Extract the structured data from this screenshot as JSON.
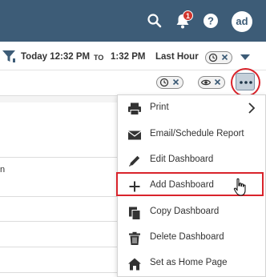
{
  "header": {
    "notification_count": "1",
    "avatar_initials": "ad",
    "bg_color": "#3d5c77"
  },
  "time_filter": {
    "from": "Today 12:32 PM",
    "to_keyword": "TO",
    "to": "1:32 PM",
    "period": "Last Hour"
  },
  "menu": {
    "items": [
      {
        "label": "Print",
        "icon": "printer-icon",
        "has_submenu": true
      },
      {
        "label": "Email/Schedule Report",
        "icon": "envelope-icon"
      },
      {
        "label": "Edit Dashboard",
        "icon": "pencil-icon"
      },
      {
        "label": "Add Dashboard",
        "icon": "plus-icon",
        "highlighted": true
      },
      {
        "label": "Copy Dashboard",
        "icon": "copy-icon"
      },
      {
        "label": "Delete Dashboard",
        "icon": "trash-icon"
      },
      {
        "label": "Set as Home Page",
        "icon": "home-icon"
      }
    ]
  },
  "background": {
    "partial_text": "n"
  },
  "colors": {
    "accent": "#3d5c77",
    "highlight": "#d9232b",
    "badge": "#d0342c"
  }
}
